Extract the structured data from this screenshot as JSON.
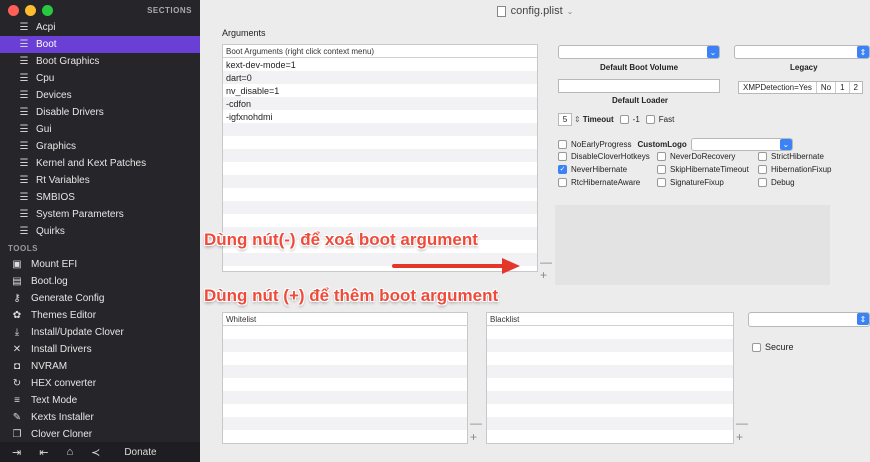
{
  "sidebar": {
    "sections_title": "SECTIONS",
    "items": [
      {
        "label": "Acpi"
      },
      {
        "label": "Boot"
      },
      {
        "label": "Boot Graphics"
      },
      {
        "label": "Cpu"
      },
      {
        "label": "Devices"
      },
      {
        "label": "Disable Drivers"
      },
      {
        "label": "Gui"
      },
      {
        "label": "Graphics"
      },
      {
        "label": "Kernel and Kext Patches"
      },
      {
        "label": "Rt Variables"
      },
      {
        "label": "SMBIOS"
      },
      {
        "label": "System Parameters"
      },
      {
        "label": "Quirks"
      }
    ],
    "active_index": 1,
    "tools_title": "TOOLS",
    "tools": [
      {
        "label": "Mount EFI",
        "icon": "disk-icon"
      },
      {
        "label": "Boot.log",
        "icon": "log-icon"
      },
      {
        "label": "Generate Config",
        "icon": "keys-icon"
      },
      {
        "label": "Themes Editor",
        "icon": "palette-icon"
      },
      {
        "label": "Install/Update Clover",
        "icon": "install-icon"
      },
      {
        "label": "Install Drivers",
        "icon": "tools-icon"
      },
      {
        "label": "NVRAM",
        "icon": "chip-icon"
      },
      {
        "label": "HEX converter",
        "icon": "refresh-icon"
      },
      {
        "label": "Text Mode",
        "icon": "lines-icon"
      },
      {
        "label": "Kexts Installer",
        "icon": "wrench-icon"
      },
      {
        "label": "Clover Cloner",
        "icon": "copy-icon"
      }
    ],
    "donate_label": "Donate"
  },
  "window": {
    "title": "config.plist"
  },
  "arguments": {
    "section_label": "Arguments",
    "list_header": "Boot Arguments (right click context menu)",
    "items": [
      "kext-dev-mode=1",
      "dart=0",
      "nv_disable=1",
      "-cdfon",
      "-igfxnohdmi"
    ]
  },
  "boot": {
    "default_boot_volume_label": "Default Boot Volume",
    "legacy_label": "Legacy",
    "default_loader_label": "Default Loader",
    "xmp_label": "XMPDetection=Yes",
    "xmp_options": [
      "No",
      "1",
      "2"
    ],
    "timeout_value": "5",
    "timeout_label": "Timeout",
    "minus1_label": "-1",
    "fast_label": "Fast",
    "nodarly_label": "NoEarlyProgress",
    "customlogo_label": "CustomLogo",
    "checkboxes": [
      {
        "label": "DisableCloverHotkeys",
        "checked": false
      },
      {
        "label": "NeverDoRecovery",
        "checked": false
      },
      {
        "label": "StrictHibernate",
        "checked": false
      },
      {
        "label": "NeverHibernate",
        "checked": true
      },
      {
        "label": "SkipHibernateTimeout",
        "checked": false
      },
      {
        "label": "HibernationFixup",
        "checked": false
      },
      {
        "label": "RtcHibernateAware",
        "checked": false
      },
      {
        "label": "SignatureFixup",
        "checked": false
      },
      {
        "label": "Debug",
        "checked": false
      }
    ]
  },
  "bottom": {
    "whitelist_label": "Whitelist",
    "blacklist_label": "Blacklist",
    "secure_label": "Secure"
  },
  "annotations": {
    "remove": "Dùng nút(-) để xoá boot argument",
    "add": "Dùng nút (+) để thêm boot argument"
  },
  "colors": {
    "sidebar_bg": "#26262a",
    "active_item": "#6a3fd6",
    "accent_blue": "#3b82f7",
    "annotation_red": "#ef4b3b"
  }
}
